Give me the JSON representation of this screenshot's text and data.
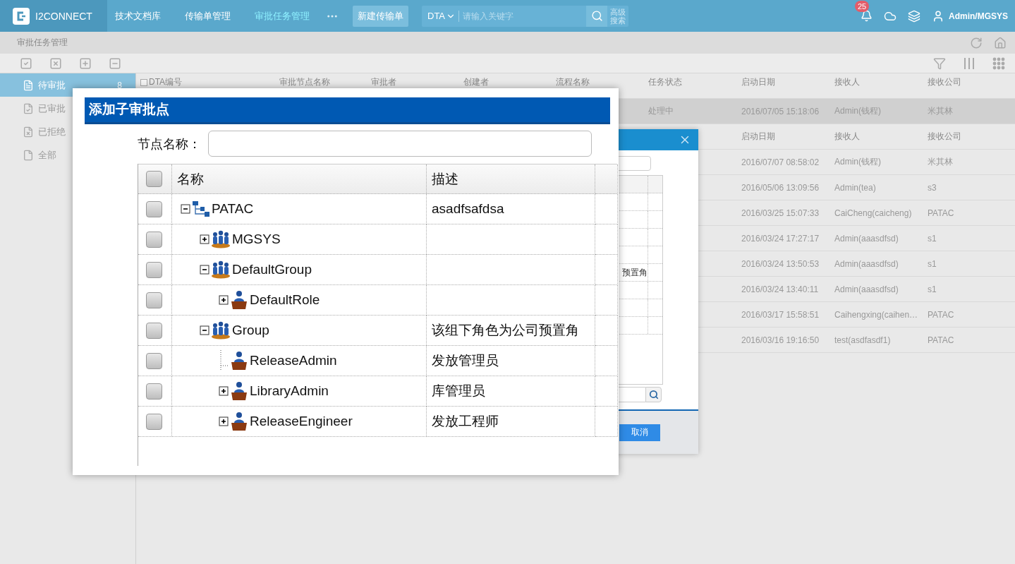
{
  "app": {
    "logo_text": "I2CONNECT"
  },
  "nav": [
    {
      "label": "技术文档库",
      "selected": false
    },
    {
      "label": "传输单管理",
      "selected": false
    },
    {
      "label": "审批任务管理",
      "selected": true
    }
  ],
  "new_button": "新建传输单",
  "search": {
    "scope": "DTA",
    "placeholder": "请输入关键字",
    "advanced": "高级搜索"
  },
  "notifications": {
    "count": "25"
  },
  "user": {
    "name": "Admin/MGSYS"
  },
  "breadcrumb": "审批任务管理",
  "sidebar": {
    "items": [
      {
        "label": "待审批",
        "count": "8",
        "selected": true,
        "kind": "pending"
      },
      {
        "label": "已审批",
        "selected": false,
        "kind": "approved"
      },
      {
        "label": "已拒绝",
        "selected": false,
        "kind": "rejected"
      },
      {
        "label": "全部",
        "selected": false,
        "kind": "all"
      }
    ]
  },
  "table": {
    "header_checked": false,
    "columns": [
      "DTA编号",
      "审批节点名称",
      "审批者",
      "创建者",
      "流程名称",
      "任务状态",
      "启动日期",
      "接收人",
      "接收公司"
    ],
    "rows": [
      {
        "kind": "data",
        "selected": true,
        "status": "处理中",
        "start_date": "2016/07/05 15:18:06",
        "receiver": "Admin(钱程)",
        "company": "米其林"
      },
      {
        "kind": "header",
        "labels": [
          "启动日期",
          "接收人",
          "接收公司"
        ]
      },
      {
        "kind": "data",
        "selected": false,
        "start_date": "2016/07/07 08:58:02",
        "receiver": "Admin(钱程)",
        "company": "米其林"
      },
      {
        "kind": "data",
        "selected": false,
        "start_date": "2016/05/06 13:09:56",
        "receiver": "Admin(tea)",
        "company": "s3"
      },
      {
        "kind": "data",
        "selected": false,
        "start_date": "2016/03/25 15:07:33",
        "receiver": "CaiCheng(caicheng)",
        "company": "PATAC"
      },
      {
        "kind": "data",
        "selected": false,
        "start_date": "2016/03/24 17:27:17",
        "receiver": "Admin(aaasdfsd)",
        "company": "s1"
      },
      {
        "kind": "data",
        "selected": false,
        "start_date": "2016/03/24 13:50:53",
        "receiver": "Admin(aaasdfsd)",
        "company": "s1"
      },
      {
        "kind": "data",
        "selected": false,
        "start_date": "2016/03/24 13:40:11",
        "receiver": "Admin(aaasdfsd)",
        "company": "s1"
      },
      {
        "kind": "data",
        "selected": false,
        "start_date": "2016/03/17 15:58:51",
        "receiver": "Caihengxing(caihen…",
        "company": "PATAC"
      },
      {
        "kind": "data",
        "selected": false,
        "start_date": "2016/03/16 19:16:50",
        "receiver": "test(asdfasdf1)",
        "company": "PATAC"
      }
    ]
  },
  "second_dialog": {
    "list_text": "预置角",
    "cancel_button": "取消"
  },
  "front_dialog": {
    "title": "添加子审批点",
    "name_label": "节点名称：",
    "columns": [
      "名称",
      "描述"
    ],
    "header_checked": false,
    "tree": [
      {
        "name": "PATAC",
        "description": "asadfsafdsa",
        "kind": "org",
        "expanded": true,
        "leaf": false,
        "checked": false,
        "children": [
          {
            "name": "MGSYS",
            "kind": "group",
            "expanded": false,
            "leaf": false,
            "checked": false
          },
          {
            "name": "DefaultGroup",
            "kind": "group",
            "expanded": true,
            "leaf": false,
            "checked": false,
            "children": [
              {
                "name": "DefaultRole",
                "kind": "role",
                "expanded": false,
                "leaf": false,
                "checked": false
              }
            ]
          },
          {
            "name": "Group",
            "description": "该组下角色为公司预置角",
            "kind": "group",
            "expanded": true,
            "leaf": false,
            "checked": false,
            "children": [
              {
                "name": "ReleaseAdmin",
                "description": "发放管理员",
                "kind": "role",
                "leaf": true,
                "checked": false
              },
              {
                "name": "LibraryAdmin",
                "description": "库管理员",
                "kind": "role",
                "expanded": false,
                "leaf": false,
                "checked": false
              },
              {
                "name": "ReleaseEngineer",
                "description": "发放工程师",
                "kind": "role",
                "expanded": false,
                "leaf": false,
                "checked": false
              }
            ]
          }
        ]
      }
    ]
  }
}
